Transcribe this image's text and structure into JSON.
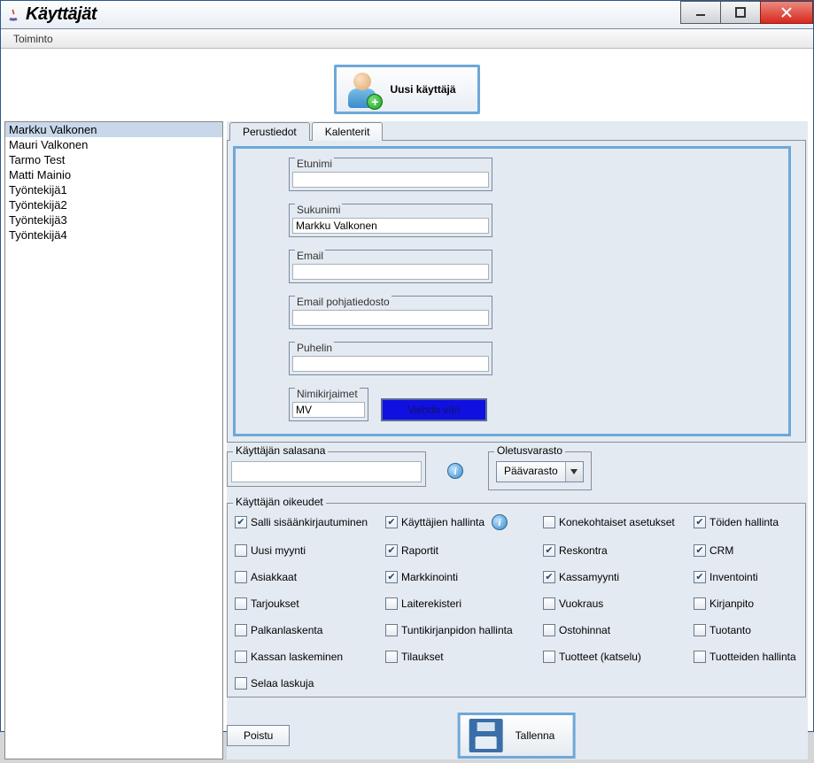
{
  "window": {
    "title": "Käyttäjät"
  },
  "menubar": {
    "items": [
      "Toiminto"
    ]
  },
  "toolbar": {
    "new_user_label": "Uusi käyttäjä"
  },
  "user_list": {
    "items": [
      "Markku Valkonen",
      "Mauri Valkonen",
      "Tarmo Test",
      "Matti Mainio",
      "Työntekijä1",
      "Työntekijä2",
      "Työntekijä3",
      "Työntekijä4"
    ],
    "selected_index": 0
  },
  "tabs": {
    "tab1": "Perustiedot",
    "tab2": "Kalenterit",
    "active": 0
  },
  "fields": {
    "firstname": {
      "label": "Etunimi",
      "value": ""
    },
    "lastname": {
      "label": "Sukunimi",
      "value": "Markku Valkonen"
    },
    "email": {
      "label": "Email",
      "value": ""
    },
    "emailtpl": {
      "label": "Email pohjatiedosto",
      "value": ""
    },
    "phone": {
      "label": "Puhelin",
      "value": ""
    },
    "initials": {
      "label": "Nimikirjaimet",
      "value": "MV"
    },
    "color_btn": "Vaihda väri"
  },
  "password_group": {
    "label": "Käyttäjän salasana",
    "value": ""
  },
  "warehouse_group": {
    "label": "Oletusvarasto",
    "selected": "Päävarasto"
  },
  "permissions": {
    "label": "Käyttäjän oikeudet",
    "items": [
      {
        "label": "Salli sisäänkirjautuminen",
        "checked": true,
        "info": false
      },
      {
        "label": "Käyttäjien hallinta",
        "checked": true,
        "info": true
      },
      {
        "label": "Konekohtaiset asetukset",
        "checked": false,
        "info": false
      },
      {
        "label": "Töiden hallinta",
        "checked": true,
        "info": false
      },
      {
        "label": "Uusi myynti",
        "checked": false
      },
      {
        "label": "Raportit",
        "checked": true
      },
      {
        "label": "Reskontra",
        "checked": true
      },
      {
        "label": "CRM",
        "checked": true
      },
      {
        "label": "Asiakkaat",
        "checked": false
      },
      {
        "label": "Markkinointi",
        "checked": true
      },
      {
        "label": "Kassamyynti",
        "checked": true
      },
      {
        "label": "Inventointi",
        "checked": true
      },
      {
        "label": "Tarjoukset",
        "checked": false
      },
      {
        "label": "Laiterekisteri",
        "checked": false
      },
      {
        "label": "Vuokraus",
        "checked": false
      },
      {
        "label": "Kirjanpito",
        "checked": false
      },
      {
        "label": "Palkanlaskenta",
        "checked": false
      },
      {
        "label": "Tuntikirjanpidon hallinta",
        "checked": false
      },
      {
        "label": "Ostohinnat",
        "checked": false
      },
      {
        "label": "Tuotanto",
        "checked": false
      },
      {
        "label": "Kassan laskeminen",
        "checked": false
      },
      {
        "label": "Tilaukset",
        "checked": false
      },
      {
        "label": "Tuotteet (katselu)",
        "checked": false
      },
      {
        "label": "Tuotteiden hallinta",
        "checked": false
      },
      {
        "label": "Selaa laskuja",
        "checked": false
      }
    ]
  },
  "buttons": {
    "exit": "Poistu",
    "save": "Tallenna"
  }
}
